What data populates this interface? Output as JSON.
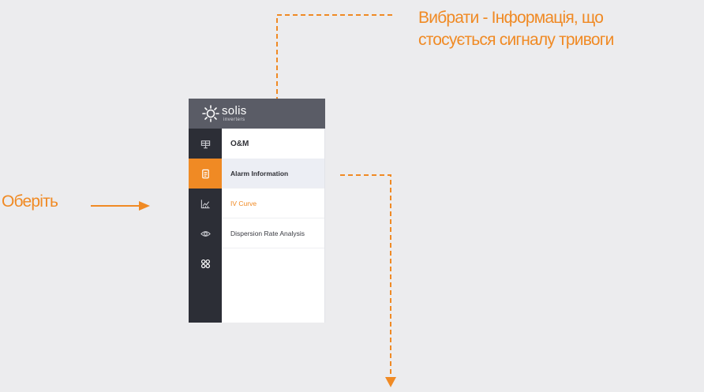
{
  "annotations": {
    "top_callout": "Вибрати - Інформація, що\nстосується сигналу тривоги",
    "left_callout": "Оберіть"
  },
  "logo": {
    "name": "solis",
    "subtitle": "inverters"
  },
  "rail": {
    "items": [
      {
        "icon": "station-icon",
        "active": false
      },
      {
        "icon": "document-icon",
        "active": true
      },
      {
        "icon": "chart-icon",
        "active": false
      },
      {
        "icon": "eye-icon",
        "active": false
      },
      {
        "icon": "apps-icon",
        "active": false
      }
    ]
  },
  "menu": {
    "title": "O&M",
    "items": [
      {
        "label": "Alarm Information",
        "state": "selected"
      },
      {
        "label": "IV Curve",
        "state": "highlight"
      },
      {
        "label": "Dispersion Rate Analysis",
        "state": "normal"
      }
    ]
  },
  "colors": {
    "accent": "#f08a24",
    "rail_bg": "#2c2e36",
    "logo_bg": "#5a5c66",
    "page_bg": "#ececee"
  }
}
